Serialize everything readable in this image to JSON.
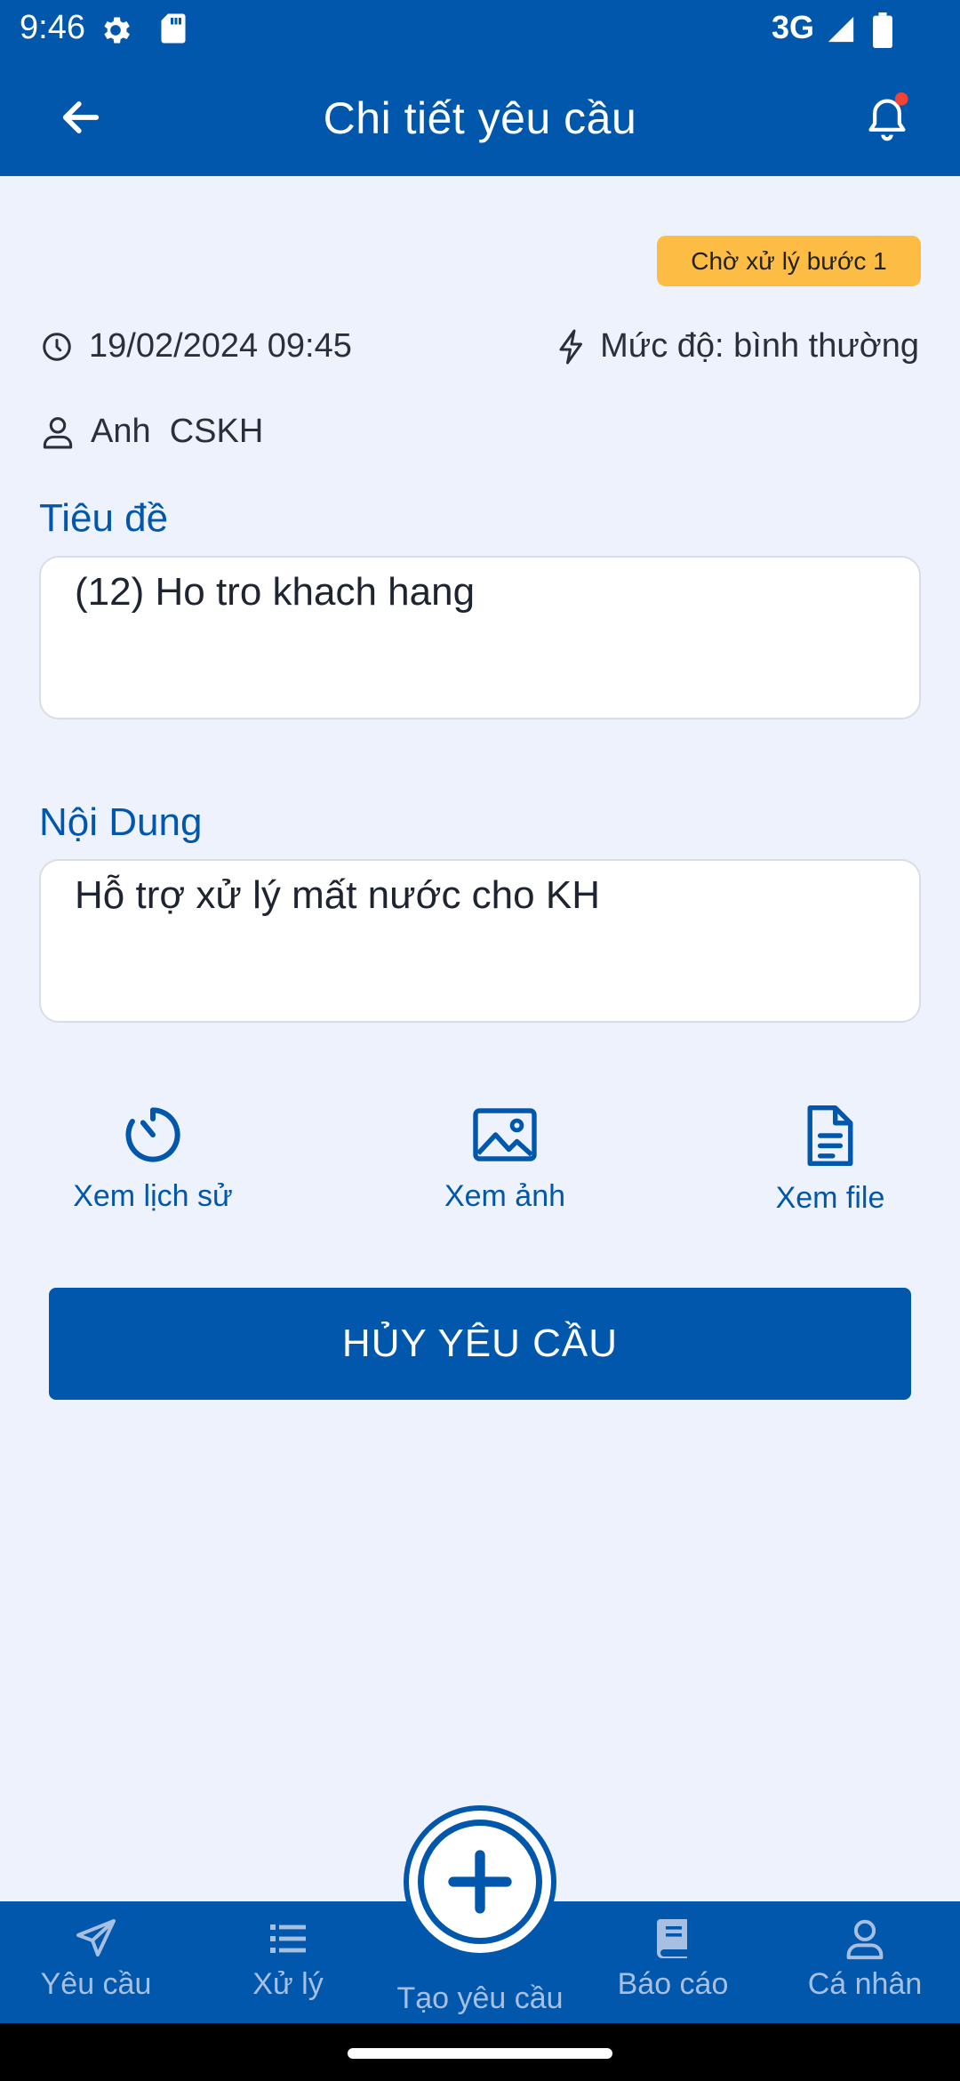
{
  "status_bar": {
    "time": "9:46",
    "network": "3G",
    "icons": [
      "settings-icon",
      "sd-card-icon",
      "signal-icon",
      "battery-icon"
    ]
  },
  "app_bar": {
    "title": "Chi tiết yêu cầu",
    "back_icon": "arrow-left-icon",
    "bell_icon": "bell-icon",
    "has_notification_dot": true
  },
  "request": {
    "status": "Chờ xử lý bước 1",
    "datetime": "19/02/2024 09:45",
    "priority": "Mức độ: bình thường",
    "user": "Anh  CSKH",
    "title_label": "Tiêu đề",
    "title_value": "(12) Ho tro khach hang",
    "content_label": "Nội Dung",
    "content_value": "Hỗ trợ xử lý mất nước cho KH"
  },
  "actions": [
    {
      "label": "Xem lịch sử",
      "icon": "history-icon"
    },
    {
      "label": "Xem ảnh",
      "icon": "image-icon"
    },
    {
      "label": "Xem file",
      "icon": "file-icon"
    }
  ],
  "cancel_button": "HỦY YÊU CẦU",
  "bottom_nav": [
    {
      "label": "Yêu cầu",
      "icon": "send-icon"
    },
    {
      "label": "Xử lý",
      "icon": "list-icon"
    },
    {
      "label": "Tạo yêu cầu",
      "icon": "plus-icon"
    },
    {
      "label": "Báo cáo",
      "icon": "book-icon"
    },
    {
      "label": "Cá nhân",
      "icon": "user-icon"
    }
  ],
  "colors": {
    "primary": "#0157ab",
    "background": "#edf2fd",
    "badge": "#fdbc43",
    "notification_dot": "#f44336",
    "nav_inactive": "#a7bfe0"
  }
}
